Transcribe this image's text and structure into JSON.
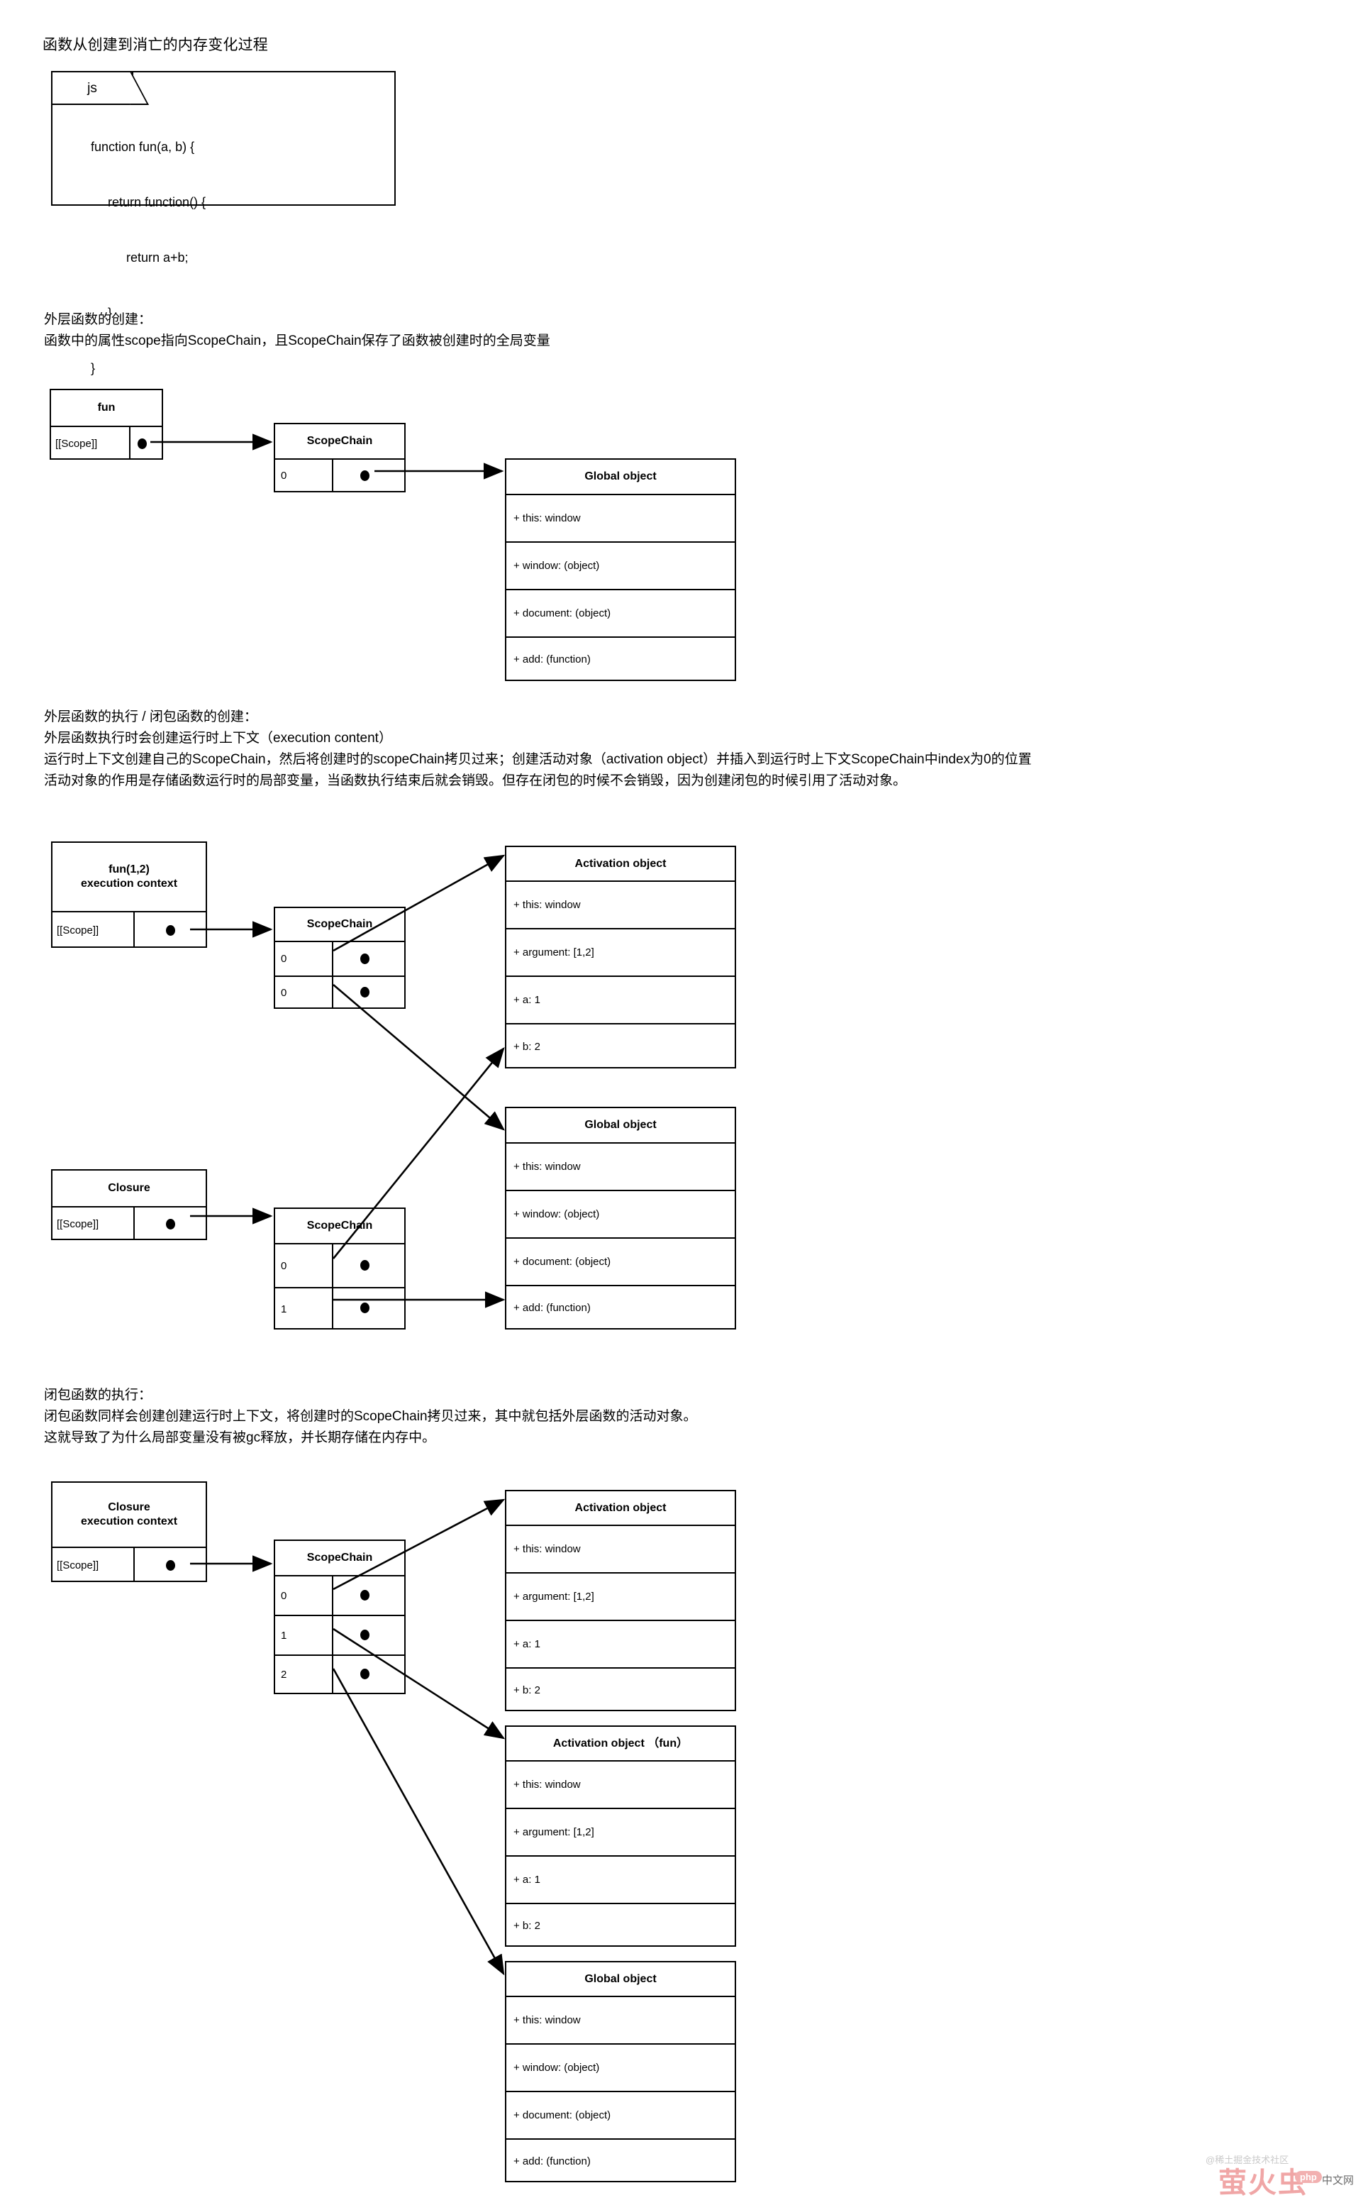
{
  "doc": {
    "title": "函数从创建到消亡的内存变化过程"
  },
  "code_card": {
    "tab_label": "js",
    "lines": [
      "function fun(a, b) {",
      "return function() {",
      "return a+b;",
      "}",
      "}"
    ]
  },
  "section1": {
    "heading": "外层函数的创建：",
    "body": [
      "函数中的属性scope指向ScopeChain，且ScopeChain保存了函数被创建时的全局变量"
    ],
    "fun_box": {
      "title": "fun",
      "scope_label": "[[Scope]]"
    },
    "scopechain": {
      "title": "ScopeChain",
      "rows": [
        {
          "index": "0"
        }
      ]
    },
    "global_object": {
      "title": "Global object",
      "rows": [
        "+ this: window",
        "+ window: (object)",
        "+ document: (object)",
        "+ add: (function)"
      ]
    }
  },
  "section2": {
    "heading": "外层函数的执行 / 闭包函数的创建：",
    "body": [
      "外层函数执行时会创建运行时上下文（execution content）",
      "运行时上下文创建自己的ScopeChain，然后将创建时的scopeChain拷贝过来；创建活动对象（activation object）并插入到运行时上下文ScopeChain中index为0的位置",
      "活动对象的作用是存储函数运行时的局部变量，当函数执行结束后就会销毁。但存在闭包的时候不会销毁，因为创建闭包的时候引用了活动对象。"
    ],
    "exec_box": {
      "title_line1": "fun(1,2)",
      "title_line2": "execution context",
      "scope_label": "[[Scope]]"
    },
    "exec_scopechain": {
      "title": "ScopeChain",
      "rows": [
        {
          "index": "0"
        },
        {
          "index": "0"
        }
      ]
    },
    "activation_object": {
      "title": "Activation object",
      "rows": [
        "+ this: window",
        "+ argument: [1,2]",
        "+ a: 1",
        "+ b: 2"
      ]
    },
    "closure_box": {
      "title": "Closure",
      "scope_label": "[[Scope]]"
    },
    "closure_scopechain": {
      "title": "ScopeChain",
      "rows": [
        {
          "index": "0"
        },
        {
          "index": "1"
        }
      ]
    },
    "global_object": {
      "title": "Global object",
      "rows": [
        "+ this: window",
        "+ window: (object)",
        "+ document: (object)",
        "+ add: (function)"
      ]
    }
  },
  "section3": {
    "heading": "闭包函数的执行：",
    "body": [
      "闭包函数同样会创建创建运行时上下文，将创建时的ScopeChain拷贝过来，其中就包括外层函数的活动对象。",
      "这就导致了为什么局部变量没有被gc释放，并长期存储在内存中。"
    ],
    "exec_box": {
      "title_line1": "Closure",
      "title_line2": "execution context",
      "scope_label": "[[Scope]]"
    },
    "exec_scopechain": {
      "title": "ScopeChain",
      "rows": [
        {
          "index": "0"
        },
        {
          "index": "1"
        },
        {
          "index": "2"
        }
      ]
    },
    "activation_object": {
      "title": "Activation object",
      "rows": [
        "+ this: window",
        "+ argument: [1,2]",
        "+ a: 1",
        "+ b: 2"
      ]
    },
    "activation_object_fun": {
      "title": "Activation object （fun）",
      "rows": [
        "+ this: window",
        "+ argument: [1,2]",
        "+ a: 1",
        "+ b: 2"
      ]
    },
    "global_object": {
      "title": "Global object",
      "rows": [
        "+ this: window",
        "+ window: (object)",
        "+ document: (object)",
        "+ add: (function)"
      ]
    }
  },
  "watermark": {
    "community": "@稀土掘金技术社区",
    "brand": "萤火虫",
    "badge": "php",
    "suffix": "中文网"
  },
  "colors": {
    "stroke": "#000000",
    "background": "#ffffff",
    "watermark_pink": "#f0a6a6",
    "watermark_gray": "#c9c9c9"
  }
}
